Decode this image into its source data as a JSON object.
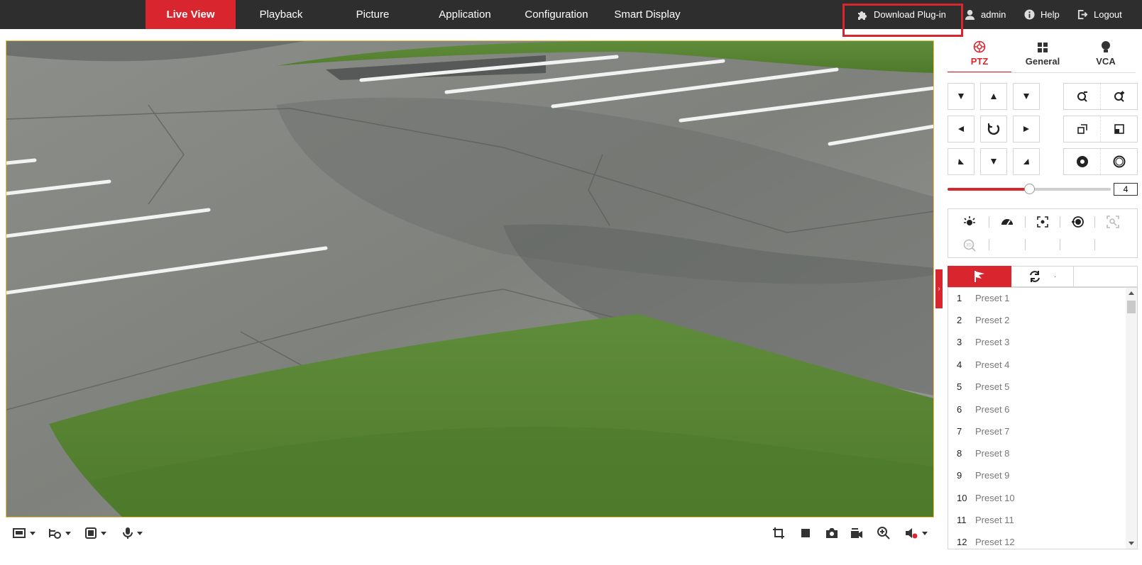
{
  "nav": {
    "items": [
      {
        "label": "Live View",
        "active": true
      },
      {
        "label": "Playback"
      },
      {
        "label": "Picture"
      },
      {
        "label": "Application"
      },
      {
        "label": "Configuration"
      },
      {
        "label": "Smart Display"
      }
    ],
    "download_plugin": "Download Plug-in",
    "user": "admin",
    "help": "Help",
    "logout": "Logout"
  },
  "colors": {
    "accent": "#d9262e",
    "topbar": "#2e2e2e",
    "highlight_box": "#d9262e"
  },
  "video": {
    "scene": "parking-lot-camera-feed"
  },
  "toolbar": {
    "left_icons": [
      "window-layout-icon",
      "stream-type-icon",
      "render-icon",
      "microphone-icon"
    ],
    "right_icons": [
      "crop-icon",
      "stop-icon",
      "snapshot-icon",
      "record-icon",
      "digital-zoom-icon",
      "volume-icon"
    ]
  },
  "panel": {
    "tabs": [
      {
        "label": "PTZ",
        "icon": "ptz-icon",
        "active": true
      },
      {
        "label": "General",
        "icon": "grid-icon"
      },
      {
        "label": "VCA",
        "icon": "bulb-icon"
      }
    ],
    "speed": {
      "value": "4",
      "level": 0.5
    },
    "preset_tabs": [
      {
        "icon": "flag-icon",
        "active": true
      },
      {
        "icon": "patrol-icon",
        "note": "·"
      }
    ],
    "presets": [
      {
        "num": "1",
        "name": "Preset 1"
      },
      {
        "num": "2",
        "name": "Preset 2"
      },
      {
        "num": "3",
        "name": "Preset 3"
      },
      {
        "num": "4",
        "name": "Preset 4"
      },
      {
        "num": "5",
        "name": "Preset 5"
      },
      {
        "num": "6",
        "name": "Preset 6"
      },
      {
        "num": "7",
        "name": "Preset 7"
      },
      {
        "num": "8",
        "name": "Preset 8"
      },
      {
        "num": "9",
        "name": "Preset 9"
      },
      {
        "num": "10",
        "name": "Preset 10"
      },
      {
        "num": "11",
        "name": "Preset 11"
      },
      {
        "num": "12",
        "name": "Preset 12"
      }
    ]
  }
}
